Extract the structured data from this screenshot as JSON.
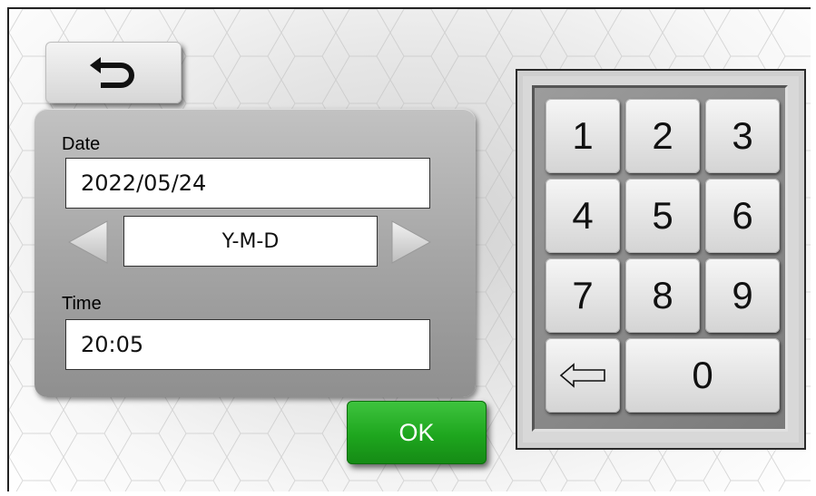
{
  "date_section": {
    "label": "Date",
    "value": "2022/05/24",
    "format": "Y-M-D"
  },
  "time_section": {
    "label": "Time",
    "value": "20:05"
  },
  "buttons": {
    "back_icon": "return-arrow-icon",
    "ok_label": "OK",
    "prev_icon": "triangle-left-icon",
    "next_icon": "triangle-right-icon"
  },
  "keypad": {
    "keys": [
      "1",
      "2",
      "3",
      "4",
      "5",
      "6",
      "7",
      "8",
      "9"
    ],
    "zero": "0",
    "backspace_icon": "backspace-arrow-icon"
  },
  "colors": {
    "ok_button": "#1ea61e",
    "panel": "#a6a6a6",
    "key_face": "#e6e6e6"
  }
}
